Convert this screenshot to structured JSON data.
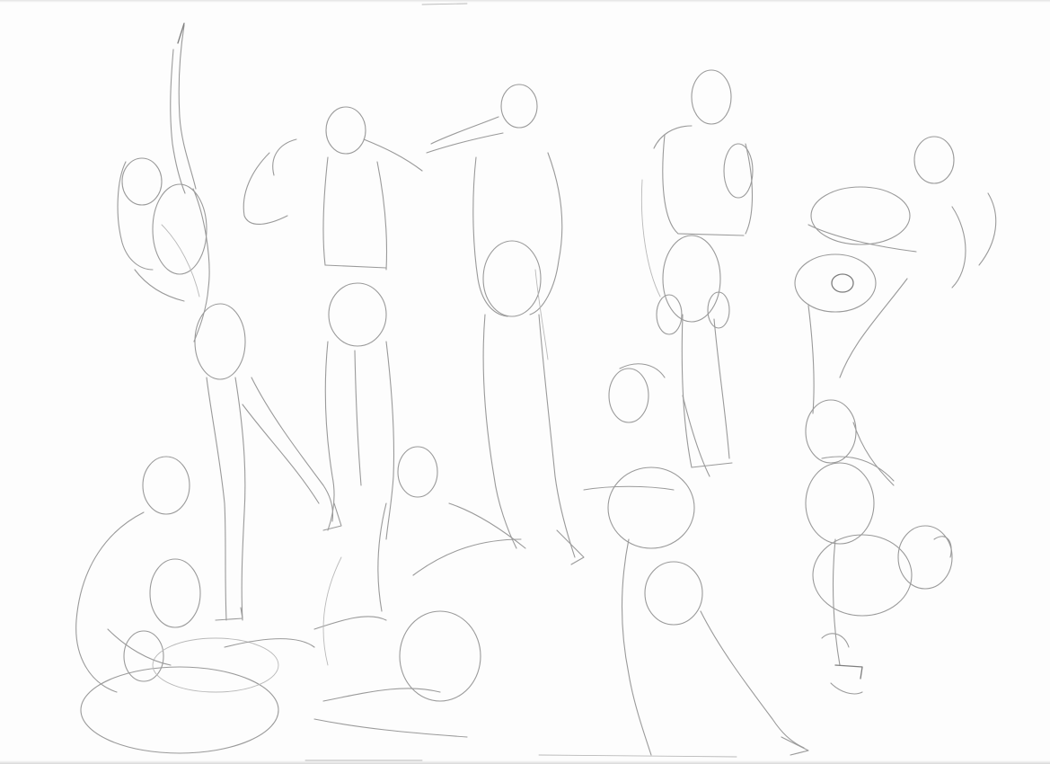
{
  "image": {
    "subject": "gesture-figure-sketches",
    "medium": "pencil",
    "paper_color": "#fdfdfd",
    "line_color": "#9a9a9a"
  }
}
